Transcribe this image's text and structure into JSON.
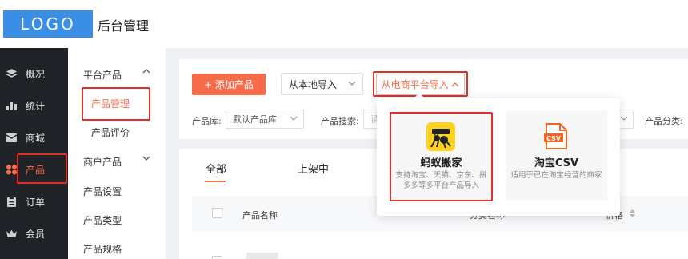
{
  "header": {
    "logo": "LOGO",
    "title": "后台管理"
  },
  "sidebar": {
    "items": [
      {
        "label": "概况",
        "icon": "layers-icon"
      },
      {
        "label": "统计",
        "icon": "chart-icon"
      },
      {
        "label": "商城",
        "icon": "store-icon"
      },
      {
        "label": "产品",
        "icon": "grid-icon",
        "active": true
      },
      {
        "label": "订单",
        "icon": "clipboard-icon"
      },
      {
        "label": "会员",
        "icon": "crown-icon"
      }
    ]
  },
  "submenu": {
    "group1": "平台产品",
    "item_manage": "产品管理",
    "item_review": "产品评价",
    "group2": "商户产品",
    "item_settings": "产品设置",
    "item_type": "产品类型",
    "item_spec": "产品规格"
  },
  "toolbar": {
    "add_button": "+ 添加产品",
    "local_import": "从本地导入",
    "ecom_import": "从电商平台导入",
    "filter_lib_label": "产品库:",
    "filter_lib_value": "默认产品库",
    "filter_search_label": "产品搜索:",
    "filter_search_placeholder": "请",
    "filter_cat_label": "产品分类:"
  },
  "list": {
    "tabs": [
      "全部",
      "上架中"
    ],
    "columns": {
      "name": "产品名称",
      "category": "分类名称",
      "price": "价格"
    }
  },
  "popup": {
    "option1": {
      "title": "蚂蚁搬家",
      "desc": "支持淘宝、天猫、京东、拼多多等多平台产品导入"
    },
    "option2": {
      "title": "淘宝CSV",
      "desc": "适用于已在淘宝经营的商家"
    }
  },
  "colors": {
    "accent": "#f56c4b",
    "logo_bg": "#3a8ee6",
    "highlight": "#e0302a",
    "sidebar_bg": "#1f2328"
  }
}
